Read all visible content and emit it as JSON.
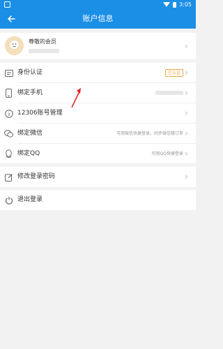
{
  "statusbar": {
    "time": "3:05"
  },
  "header": {
    "title": "账户信息"
  },
  "profile": {
    "name": "尊敬的会员"
  },
  "menu": {
    "identity_label": "身份认证",
    "identity_badge": "已认证",
    "phone_label": "绑定手机",
    "account_label": "12306账号管理",
    "wechat_label": "绑定微信",
    "wechat_hint": "可用微信快捷登录，同步微信猜订单",
    "qq_label": "绑定QQ",
    "qq_hint": "可用QQ快捷登录",
    "password_label": "修改登录密码",
    "logout_label": "退出登录"
  },
  "colors": {
    "brand": "#1b8fe6",
    "badge": "#f0a33a",
    "annotation_arrow": "#e02020"
  }
}
